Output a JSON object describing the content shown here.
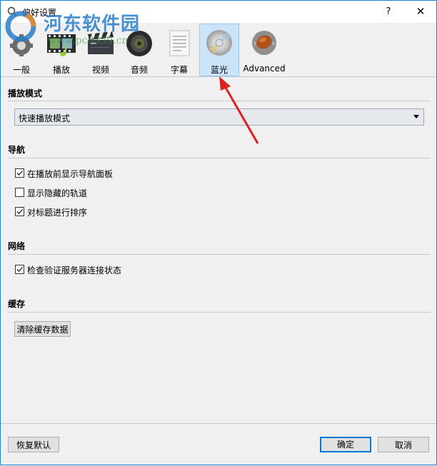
{
  "window": {
    "title": "偏好设置",
    "help_label": "?",
    "close_label": "✕",
    "accent_color": "#0078d7"
  },
  "watermark": {
    "text": "河东软件园",
    "url_text": "www.pc0359.cn"
  },
  "toolbar": {
    "items": [
      {
        "label": "一般",
        "icon": "gear-icon",
        "selected": false
      },
      {
        "label": "播放",
        "icon": "film-music-icon",
        "selected": false
      },
      {
        "label": "视频",
        "icon": "clapperboard-icon",
        "selected": false
      },
      {
        "label": "音频",
        "icon": "speaker-icon",
        "selected": false
      },
      {
        "label": "字幕",
        "icon": "document-icon",
        "selected": false
      },
      {
        "label": "蓝光",
        "icon": "disc-icon",
        "selected": true
      },
      {
        "label": "Advanced",
        "icon": "advanced-icon",
        "selected": false
      }
    ]
  },
  "sections": {
    "playback_mode": {
      "title": "播放模式",
      "dropdown_value": "快速播放模式"
    },
    "navigation": {
      "title": "导航",
      "options": [
        {
          "label": "在播放前显示导航面板",
          "checked": true
        },
        {
          "label": "显示隐藏的轨道",
          "checked": false
        },
        {
          "label": "对标题进行排序",
          "checked": true
        }
      ]
    },
    "network": {
      "title": "网络",
      "options": [
        {
          "label": "检查验证服务器连接状态",
          "checked": true
        }
      ]
    },
    "cache": {
      "title": "缓存",
      "clear_button": "清除缓存数据"
    }
  },
  "footer": {
    "restore_defaults": "恢复默认",
    "ok": "确定",
    "cancel": "取消"
  }
}
